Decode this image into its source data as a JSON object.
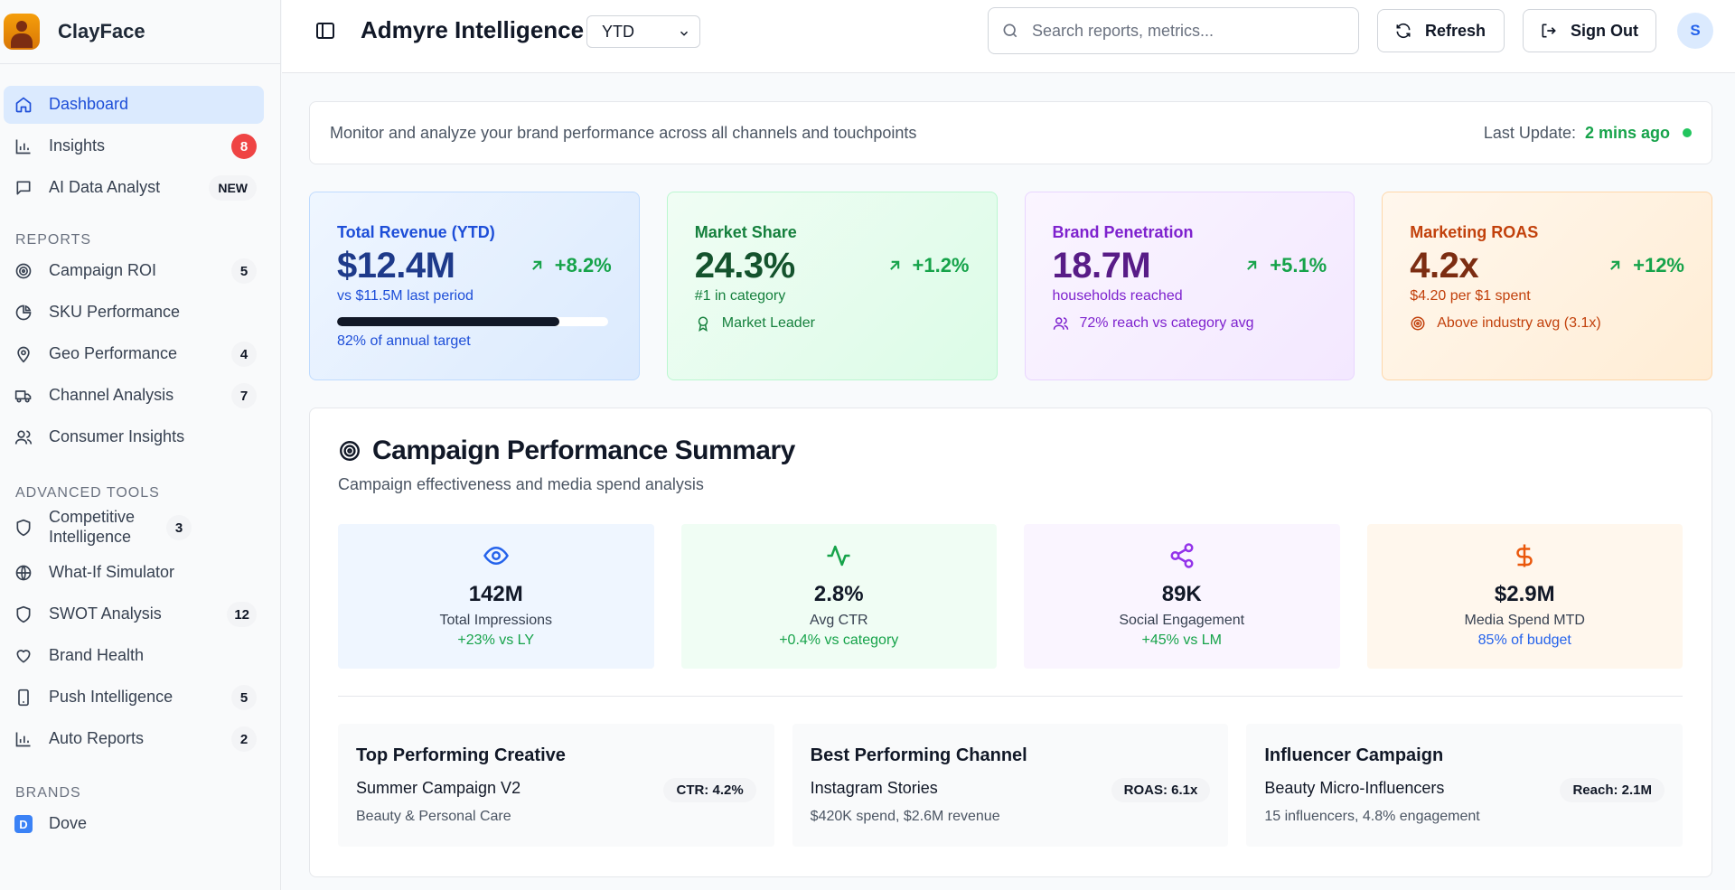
{
  "sidebar": {
    "brand_name": "ClayFace",
    "main_items": [
      {
        "label": "Dashboard",
        "icon": "home-icon",
        "active": true
      },
      {
        "label": "Insights",
        "icon": "bar-chart-icon",
        "badge": "8"
      },
      {
        "label": "AI Data Analyst",
        "icon": "message-square-icon",
        "badge": "NEW"
      }
    ],
    "reports_heading": "REPORTS",
    "reports": [
      {
        "label": "Campaign ROI",
        "icon": "target-icon",
        "badge": "5"
      },
      {
        "label": "SKU Performance",
        "icon": "pie-chart-icon"
      },
      {
        "label": "Geo Performance",
        "icon": "map-pin-icon",
        "badge": "4"
      },
      {
        "label": "Channel Analysis",
        "icon": "truck-icon",
        "badge": "7"
      },
      {
        "label": "Consumer Insights",
        "icon": "users-icon"
      }
    ],
    "tools_heading": "ADVANCED TOOLS",
    "tools": [
      {
        "label": "Competitive Intelligence",
        "icon": "shield-icon",
        "badge": "3"
      },
      {
        "label": "What-If Simulator",
        "icon": "globe-icon"
      },
      {
        "label": "SWOT Analysis",
        "icon": "shield-icon",
        "badge": "12"
      },
      {
        "label": "Brand Health",
        "icon": "heart-icon"
      },
      {
        "label": "Push Intelligence",
        "icon": "smartphone-icon",
        "badge": "5"
      },
      {
        "label": "Auto Reports",
        "icon": "bar-chart-icon",
        "badge": "2"
      }
    ],
    "brands_heading": "BRANDS",
    "brands": [
      {
        "label": "Dove",
        "initial": "D"
      }
    ]
  },
  "header": {
    "title": "Admyre Intelligence",
    "period": "YTD",
    "search_placeholder": "Search reports, metrics...",
    "refresh_label": "Refresh",
    "signout_label": "Sign Out",
    "avatar_initial": "S"
  },
  "subtitle": {
    "text": "Monitor and analyze your brand performance across all channels and touchpoints",
    "last_update_label": "Last Update:",
    "last_update_value": "2 mins ago"
  },
  "kpis": {
    "revenue": {
      "label": "Total Revenue (YTD)",
      "value": "$12.4M",
      "change": "+8.2%",
      "sub": "vs $11.5M last period",
      "progress": 0.82,
      "foot": "82% of annual target"
    },
    "market_share": {
      "label": "Market Share",
      "value": "24.3%",
      "change": "+1.2%",
      "sub": "#1 in category",
      "foot": "Market Leader"
    },
    "penetration": {
      "label": "Brand Penetration",
      "value": "18.7M",
      "change": "+5.1%",
      "sub": "households reached",
      "foot": "72% reach vs category avg"
    },
    "roas": {
      "label": "Marketing ROAS",
      "value": "4.2x",
      "change": "+12%",
      "sub": "$4.20 per $1 spent",
      "foot": "Above industry avg (3.1x)"
    }
  },
  "campaign": {
    "title": "Campaign Performance Summary",
    "description": "Campaign effectiveness and media spend analysis",
    "metrics": [
      {
        "value": "142M",
        "label": "Total Impressions",
        "delta": "+23% vs LY",
        "icon": "eye-icon"
      },
      {
        "value": "2.8%",
        "label": "Avg CTR",
        "delta": "+0.4% vs category",
        "icon": "activity-icon"
      },
      {
        "value": "89K",
        "label": "Social Engagement",
        "delta": "+45% vs LM",
        "icon": "share-icon"
      },
      {
        "value": "$2.9M",
        "label": "Media Spend MTD",
        "delta": "85% of budget",
        "icon": "dollar-icon"
      }
    ],
    "highlights": [
      {
        "title": "Top Performing Creative",
        "name": "Summer Campaign V2",
        "pill": "CTR: 4.2%",
        "detail": "Beauty & Personal Care"
      },
      {
        "title": "Best Performing Channel",
        "name": "Instagram Stories",
        "pill": "ROAS: 6.1x",
        "detail": "$420K spend, $2.6M revenue"
      },
      {
        "title": "Influencer Campaign",
        "name": "Beauty Micro-Influencers",
        "pill": "Reach: 2.1M",
        "detail": "15 influencers, 4.8% engagement"
      }
    ]
  },
  "colors": {
    "accent": "#2563eb",
    "positive": "#16a34a",
    "alert_badge": "#ef4444"
  }
}
